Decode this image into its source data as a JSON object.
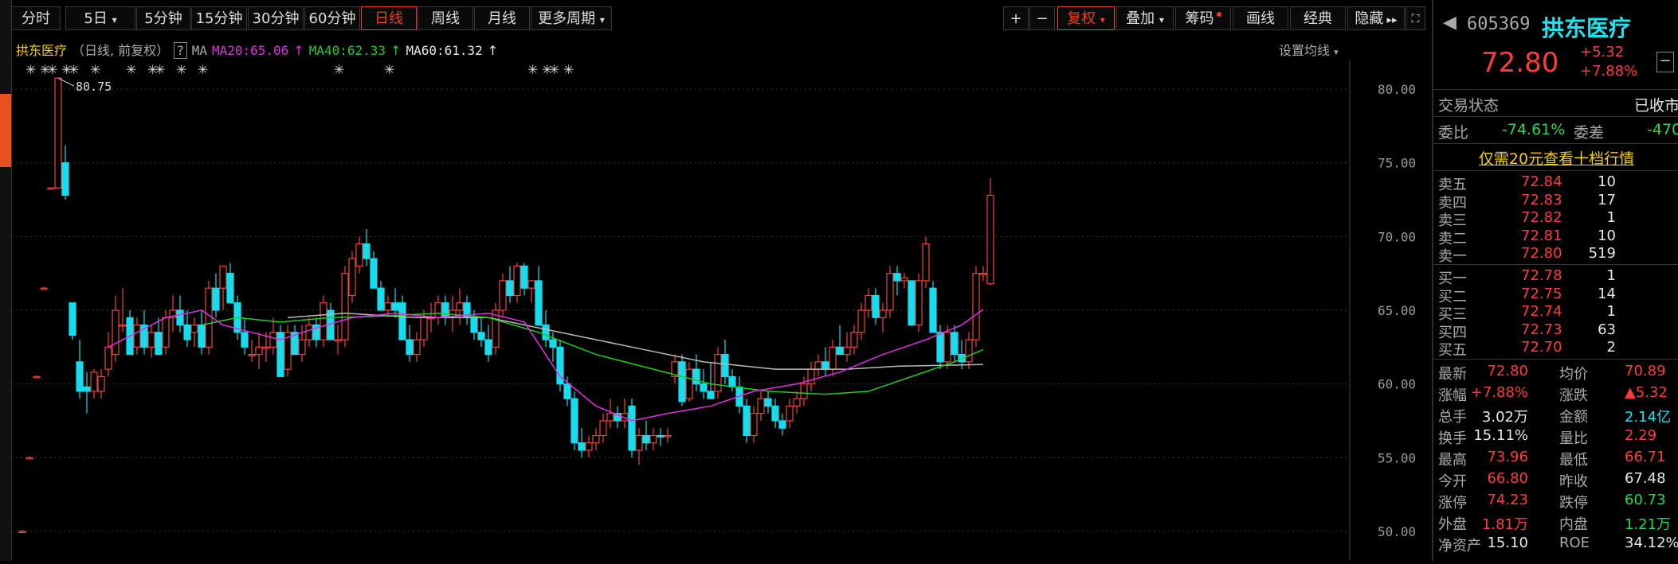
{
  "toolbar": {
    "tabs": [
      "分时",
      "5日",
      "5分钟",
      "15分钟",
      "30分钟",
      "60分钟",
      "日线",
      "周线",
      "月线",
      "更多周期"
    ],
    "active_tab": "日线",
    "plus": "+",
    "minus": "−",
    "fuquan": "复权",
    "diejia": "叠加",
    "chouma": "筹码",
    "huaxian": "画线",
    "jingdian": "经典",
    "yincang": "隐藏"
  },
  "infobar": {
    "name": "拱东医疗",
    "mode": "（日线, 前复权）",
    "help": "?",
    "ma": "MA",
    "ma20": "MA20:65.06",
    "ma40": "MA40:62.33",
    "ma60": "MA60:61.32",
    "settings": "设置均线"
  },
  "colors": {
    "up": "#f0423c",
    "down": "#16dced",
    "ma20": "#e030e0",
    "ma40": "#22cc22",
    "ma60": "#bbbbbb",
    "grid": "#3a3a3a"
  },
  "chart_data": {
    "type": "candlestick",
    "ylim": [
      48,
      82
    ],
    "y_ticks": [
      "80.00",
      "75.00",
      "70.00",
      "65.00",
      "60.00",
      "55.00",
      "50.00"
    ],
    "max_label": "80.75",
    "ohlc": [
      [
        50.0,
        50.1,
        49.9,
        50.0
      ],
      [
        55.0,
        55.1,
        54.9,
        55.0
      ],
      [
        60.5,
        60.6,
        60.4,
        60.5
      ],
      [
        66.5,
        66.6,
        66.4,
        66.5
      ],
      [
        73.3,
        73.3,
        73.3,
        73.3
      ],
      [
        73.3,
        80.75,
        73.3,
        80.75
      ],
      [
        75.0,
        76.2,
        72.5,
        72.8
      ],
      [
        65.5,
        65.5,
        63.0,
        63.3
      ],
      [
        61.5,
        63.0,
        59.0,
        59.5
      ],
      [
        59.8,
        60.8,
        58.0,
        59.5
      ],
      [
        59.5,
        61.0,
        59.0,
        60.8
      ],
      [
        59.5,
        61.0,
        59.0,
        60.5
      ],
      [
        61.0,
        63.5,
        60.5,
        62.5
      ],
      [
        62.0,
        66.0,
        61.5,
        65.0
      ],
      [
        64.0,
        66.5,
        63.5,
        64.0
      ],
      [
        64.5,
        65.0,
        62.0,
        62.0
      ],
      [
        62.5,
        64.5,
        62.0,
        64.0
      ],
      [
        64.0,
        65.0,
        62.0,
        62.5
      ],
      [
        62.5,
        64.0,
        61.8,
        63.5
      ],
      [
        63.5,
        64.5,
        62.0,
        62.0
      ],
      [
        62.5,
        65.0,
        62.0,
        64.5
      ],
      [
        64.5,
        66.0,
        63.5,
        65.0
      ],
      [
        65.0,
        66.0,
        63.5,
        64.0
      ],
      [
        64.0,
        65.0,
        62.5,
        63.0
      ],
      [
        63.5,
        64.5,
        62.5,
        64.0
      ],
      [
        64.0,
        65.0,
        62.0,
        62.5
      ],
      [
        62.5,
        67.0,
        62.0,
        66.5
      ],
      [
        66.5,
        67.5,
        64.5,
        65.0
      ],
      [
        66.5,
        68.0,
        65.0,
        68.0
      ],
      [
        67.5,
        68.2,
        65.5,
        65.5
      ],
      [
        65.5,
        66.0,
        63.0,
        63.5
      ],
      [
        63.5,
        64.5,
        62.0,
        62.5
      ],
      [
        62.0,
        63.0,
        61.5,
        62.0
      ],
      [
        62.0,
        63.5,
        61.0,
        62.5
      ],
      [
        62.5,
        63.5,
        61.5,
        62.5
      ],
      [
        62.5,
        64.5,
        62.0,
        63.5
      ],
      [
        63.5,
        64.0,
        60.5,
        60.5
      ],
      [
        61.0,
        64.0,
        60.5,
        63.5
      ],
      [
        63.5,
        64.0,
        62.0,
        62.0
      ],
      [
        62.0,
        64.0,
        61.5,
        63.0
      ],
      [
        63.0,
        64.5,
        62.5,
        64.0
      ],
      [
        64.0,
        64.5,
        62.5,
        63.0
      ],
      [
        63.0,
        66.0,
        62.5,
        65.5
      ],
      [
        65.0,
        65.5,
        63.0,
        63.0
      ],
      [
        63.0,
        64.0,
        62.0,
        63.0
      ],
      [
        63.0,
        68.0,
        62.5,
        67.5
      ],
      [
        66.0,
        69.0,
        65.5,
        68.5
      ],
      [
        68.0,
        70.0,
        67.5,
        69.5
      ],
      [
        69.5,
        70.5,
        68.0,
        68.5
      ],
      [
        68.5,
        69.0,
        66.5,
        66.5
      ],
      [
        66.5,
        67.0,
        65.0,
        65.0
      ],
      [
        65.0,
        66.0,
        64.5,
        65.5
      ],
      [
        65.5,
        66.5,
        64.5,
        65.0
      ],
      [
        65.5,
        66.0,
        63.0,
        63.0
      ],
      [
        63.0,
        64.0,
        61.5,
        62.0
      ],
      [
        62.0,
        63.5,
        61.5,
        63.0
      ],
      [
        63.0,
        65.0,
        62.5,
        64.5
      ],
      [
        64.5,
        65.5,
        63.5,
        64.5
      ],
      [
        64.5,
        66.0,
        64.0,
        65.5
      ],
      [
        65.5,
        66.0,
        64.0,
        64.5
      ],
      [
        64.5,
        66.0,
        63.5,
        65.0
      ],
      [
        65.0,
        66.5,
        64.0,
        65.5
      ],
      [
        65.5,
        66.0,
        64.0,
        64.5
      ],
      [
        64.5,
        65.0,
        63.0,
        63.5
      ],
      [
        63.5,
        64.5,
        62.5,
        63.0
      ],
      [
        63.0,
        64.0,
        61.5,
        62.0
      ],
      [
        62.5,
        65.5,
        62.0,
        65.0
      ],
      [
        65.0,
        67.5,
        64.5,
        67.0
      ],
      [
        67.0,
        68.0,
        65.5,
        66.0
      ],
      [
        66.0,
        68.2,
        65.5,
        68.0
      ],
      [
        68.0,
        68.2,
        66.0,
        66.5
      ],
      [
        66.5,
        67.0,
        65.5,
        67.0
      ],
      [
        67.0,
        68.0,
        64.0,
        64.0
      ],
      [
        64.0,
        65.0,
        62.5,
        63.0
      ],
      [
        63.0,
        63.5,
        61.5,
        62.5
      ],
      [
        62.5,
        63.0,
        59.5,
        60.0
      ],
      [
        60.0,
        60.5,
        58.5,
        59.0
      ],
      [
        59.0,
        59.5,
        55.5,
        56.0
      ],
      [
        56.0,
        57.0,
        55.0,
        55.5
      ],
      [
        55.5,
        56.5,
        55.0,
        56.0
      ],
      [
        56.0,
        57.0,
        55.5,
        56.5
      ],
      [
        56.5,
        58.0,
        56.0,
        57.5
      ],
      [
        57.5,
        59.0,
        57.0,
        58.0
      ],
      [
        58.0,
        58.5,
        57.0,
        57.5
      ],
      [
        57.5,
        59.0,
        57.0,
        58.0
      ],
      [
        58.5,
        59.0,
        55.0,
        55.5
      ],
      [
        55.5,
        57.0,
        54.5,
        56.5
      ],
      [
        56.5,
        57.5,
        55.5,
        56.0
      ],
      [
        56.0,
        57.0,
        55.5,
        56.5
      ],
      [
        56.5,
        57.0,
        55.8,
        56.4
      ],
      [
        56.5,
        57.0,
        56.0,
        56.5
      ],
      [
        60.5,
        62.0,
        60.0,
        61.5
      ],
      [
        61.5,
        62.0,
        58.5,
        58.8
      ],
      [
        59.0,
        61.5,
        58.8,
        61.0
      ],
      [
        61.0,
        62.0,
        59.5,
        60.0
      ],
      [
        60.0,
        61.0,
        59.0,
        59.5
      ],
      [
        59.5,
        61.5,
        59.0,
        59.0
      ],
      [
        59.5,
        62.5,
        59.0,
        62.0
      ],
      [
        62.0,
        63.0,
        60.0,
        60.5
      ],
      [
        60.5,
        61.0,
        59.5,
        59.8
      ],
      [
        59.8,
        60.5,
        58.0,
        58.5
      ],
      [
        58.5,
        59.0,
        56.0,
        56.5
      ],
      [
        56.5,
        58.5,
        56.0,
        58.0
      ],
      [
        58.0,
        59.5,
        57.5,
        59.0
      ],
      [
        59.0,
        59.5,
        58.0,
        58.5
      ],
      [
        58.5,
        59.0,
        57.0,
        57.5
      ],
      [
        57.5,
        58.0,
        56.5,
        57.0
      ],
      [
        57.5,
        59.0,
        57.0,
        58.5
      ],
      [
        58.5,
        59.5,
        58.0,
        59.0
      ],
      [
        59.0,
        60.5,
        58.5,
        60.0
      ],
      [
        60.0,
        61.5,
        59.5,
        61.0
      ],
      [
        61.0,
        62.0,
        60.5,
        61.5
      ],
      [
        61.5,
        62.5,
        60.5,
        61.0
      ],
      [
        61.0,
        63.0,
        60.5,
        62.5
      ],
      [
        62.5,
        64.0,
        62.0,
        62.0
      ],
      [
        62.0,
        63.5,
        61.5,
        62.5
      ],
      [
        62.5,
        64.0,
        62.0,
        63.5
      ],
      [
        63.5,
        65.5,
        63.0,
        65.0
      ],
      [
        65.0,
        66.5,
        64.5,
        66.0
      ],
      [
        66.0,
        66.5,
        64.0,
        64.5
      ],
      [
        64.5,
        65.5,
        63.5,
        65.0
      ],
      [
        65.0,
        68.0,
        64.5,
        67.5
      ],
      [
        67.5,
        68.0,
        66.0,
        67.0
      ],
      [
        67.0,
        67.5,
        66.5,
        67.2
      ],
      [
        67.0,
        67.0,
        64.0,
        64.0
      ],
      [
        64.0,
        67.5,
        63.5,
        67.0
      ],
      [
        67.0,
        70.0,
        66.5,
        69.5
      ],
      [
        66.5,
        67.0,
        63.5,
        63.5
      ],
      [
        63.5,
        64.0,
        61.0,
        61.5
      ],
      [
        61.5,
        64.0,
        61.0,
        63.5
      ],
      [
        63.5,
        64.0,
        61.5,
        62.0
      ],
      [
        62.0,
        63.0,
        61.0,
        61.5
      ],
      [
        61.5,
        63.5,
        61.0,
        63.0
      ],
      [
        63.0,
        68.0,
        62.5,
        67.5
      ],
      [
        67.5,
        68.0,
        67.0,
        67.5
      ],
      [
        66.8,
        73.96,
        66.7,
        72.8
      ]
    ],
    "events_x": [
      1,
      3,
      4,
      6,
      7,
      10,
      15,
      18,
      19,
      22,
      25,
      44,
      51,
      71,
      73,
      74,
      76
    ],
    "ma20": [
      [
        12,
        62.5
      ],
      [
        16,
        63.5
      ],
      [
        20,
        64.5
      ],
      [
        25,
        65.0
      ],
      [
        28,
        64.0
      ],
      [
        32,
        63.5
      ],
      [
        36,
        63.0
      ],
      [
        41,
        63.8
      ],
      [
        46,
        64.5
      ],
      [
        52,
        64.8
      ],
      [
        58,
        64.5
      ],
      [
        65,
        64.8
      ],
      [
        70,
        64.2
      ],
      [
        75,
        60.5
      ],
      [
        80,
        58.5
      ],
      [
        85,
        57.5
      ],
      [
        90,
        58.0
      ],
      [
        96,
        58.5
      ],
      [
        102,
        59.5
      ],
      [
        108,
        60.0
      ],
      [
        114,
        60.8
      ],
      [
        120,
        62.0
      ],
      [
        126,
        63.0
      ],
      [
        131,
        64.0
      ],
      [
        134,
        65.06
      ]
    ],
    "ma40": [
      [
        25,
        64.0
      ],
      [
        30,
        64.5
      ],
      [
        36,
        64.2
      ],
      [
        43,
        64.5
      ],
      [
        50,
        64.6
      ],
      [
        58,
        64.8
      ],
      [
        65,
        64.5
      ],
      [
        72,
        63.5
      ],
      [
        80,
        62.0
      ],
      [
        88,
        61.0
      ],
      [
        96,
        60.0
      ],
      [
        104,
        59.5
      ],
      [
        112,
        59.3
      ],
      [
        118,
        59.5
      ],
      [
        124,
        60.5
      ],
      [
        130,
        61.5
      ],
      [
        134,
        62.33
      ]
    ],
    "ma60": [
      [
        37,
        64.5
      ],
      [
        45,
        64.8
      ],
      [
        55,
        64.5
      ],
      [
        65,
        64.5
      ],
      [
        75,
        63.5
      ],
      [
        85,
        62.5
      ],
      [
        95,
        61.5
      ],
      [
        105,
        61.0
      ],
      [
        115,
        61.0
      ],
      [
        122,
        61.2
      ],
      [
        134,
        61.32
      ]
    ]
  },
  "quote": {
    "code": "605369",
    "name": "拱东医疗",
    "price": "72.80",
    "change": "+5.32",
    "pct": "+7.88%",
    "status_label": "交易状态",
    "status_value": "已收市",
    "weibi_label": "委比",
    "weibi_value": "-74.61%",
    "weicha_label": "委差",
    "weicha_value": "-470",
    "promo": "仅需20元查看十档行情",
    "sell": [
      {
        "label": "卖五",
        "price": "72.84",
        "vol": "10"
      },
      {
        "label": "卖四",
        "price": "72.83",
        "vol": "17"
      },
      {
        "label": "卖三",
        "price": "72.82",
        "vol": "1"
      },
      {
        "label": "卖二",
        "price": "72.81",
        "vol": "10"
      },
      {
        "label": "卖一",
        "price": "72.80",
        "vol": "519"
      }
    ],
    "buy": [
      {
        "label": "买一",
        "price": "72.78",
        "vol": "1"
      },
      {
        "label": "买二",
        "price": "72.75",
        "vol": "14"
      },
      {
        "label": "买三",
        "price": "72.74",
        "vol": "1"
      },
      {
        "label": "买四",
        "price": "72.73",
        "vol": "63"
      },
      {
        "label": "买五",
        "price": "72.70",
        "vol": "2"
      }
    ],
    "stats": [
      {
        "l1": "最新",
        "v1": "72.80",
        "c1": "red",
        "l2": "均价",
        "v2": "70.89",
        "c2": "red"
      },
      {
        "l1": "涨幅",
        "v1": "+7.88%",
        "c1": "red",
        "l2": "涨跌",
        "v2": "▲5.32",
        "c2": "red"
      },
      {
        "l1": "总手",
        "v1": "3.02万",
        "c1": "white",
        "l2": "金额",
        "v2": "2.14亿",
        "c2": "cyan"
      },
      {
        "l1": "换手",
        "v1": "15.11%",
        "c1": "white",
        "l2": "量比",
        "v2": "2.29",
        "c2": "red"
      },
      {
        "l1": "最高",
        "v1": "73.96",
        "c1": "red",
        "l2": "最低",
        "v2": "66.71",
        "c2": "red"
      },
      {
        "l1": "今开",
        "v1": "66.80",
        "c1": "red",
        "l2": "昨收",
        "v2": "67.48",
        "c2": "white"
      },
      {
        "l1": "涨停",
        "v1": "74.23",
        "c1": "red",
        "l2": "跌停",
        "v2": "60.73",
        "c2": "green"
      },
      {
        "l1": "外盘",
        "v1": "1.81万",
        "c1": "red",
        "l2": "内盘",
        "v2": "1.21万",
        "c2": "green"
      },
      {
        "l1": "净资产",
        "v1": "15.10",
        "c1": "white",
        "l2": "ROE",
        "v2": "34.12%",
        "c2": "white"
      }
    ]
  }
}
